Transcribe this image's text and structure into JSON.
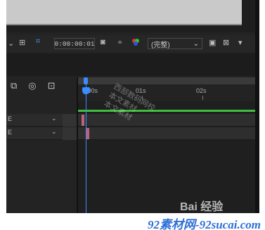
{
  "viewer": {
    "timecode": "0:00:00:01",
    "resolution": "(完整)",
    "resolution_caret": "⌄"
  },
  "timeline": {
    "tick_labels": [
      "):00s",
      "01s",
      "02s"
    ],
    "layers": [
      {
        "num": "E",
        "chevron": "⌄"
      },
      {
        "num": "E",
        "chevron": "⌄"
      }
    ]
  },
  "watermark_lines": [
    "西部数码网校",
    "本文素材",
    "本文素材"
  ],
  "baidu_logo": "Bai 经验",
  "footer": {
    "site": "92素材网-92sucai.com"
  },
  "colors": {
    "playhead": "#3a8cff",
    "work_area": "#3fbf3f",
    "clip_marker": "#c0617a",
    "footer_text": "#2f6fd6"
  }
}
